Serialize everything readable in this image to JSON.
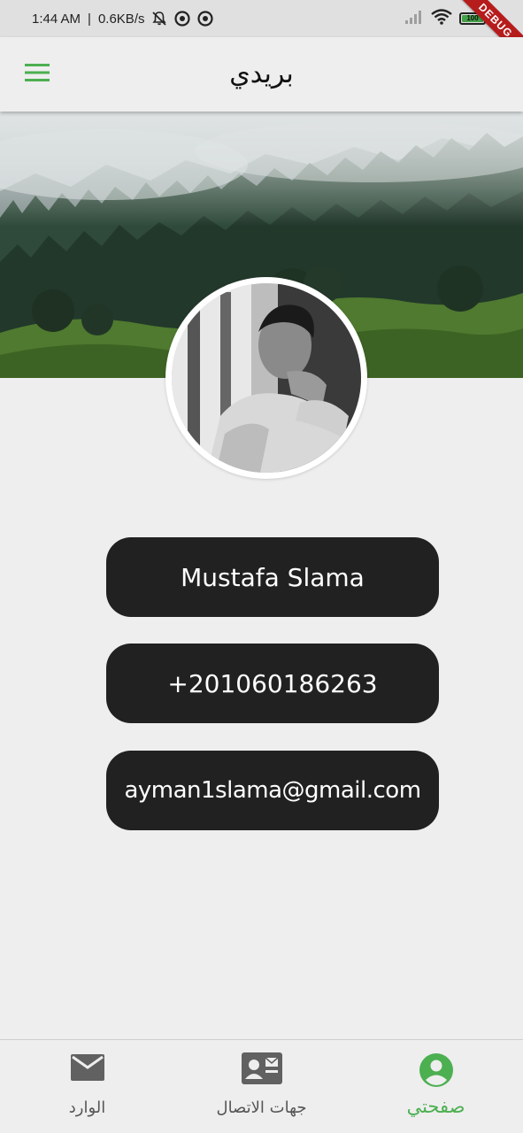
{
  "status_bar": {
    "time": "1:44 AM",
    "separator": "|",
    "speed": "0.6KB/s",
    "battery_level": "100",
    "debug_banner": "DEBUG"
  },
  "app_bar": {
    "title": "بريدي",
    "menu_icon": "hamburger-menu-icon"
  },
  "profile": {
    "name": "Mustafa Slama",
    "phone": "+201060186263",
    "email": "ayman1slama@gmail.com"
  },
  "bottom_nav": {
    "items": [
      {
        "label": "الوارد",
        "icon": "mail-icon",
        "active": false
      },
      {
        "label": "جهات الاتصال",
        "icon": "contact-card-icon",
        "active": false
      },
      {
        "label": "صفحتي",
        "icon": "account-circle-icon",
        "active": true
      }
    ]
  },
  "colors": {
    "accent": "#4caf50",
    "background": "#eeeeee",
    "pill": "#212121",
    "debug": "#b71c1c"
  }
}
